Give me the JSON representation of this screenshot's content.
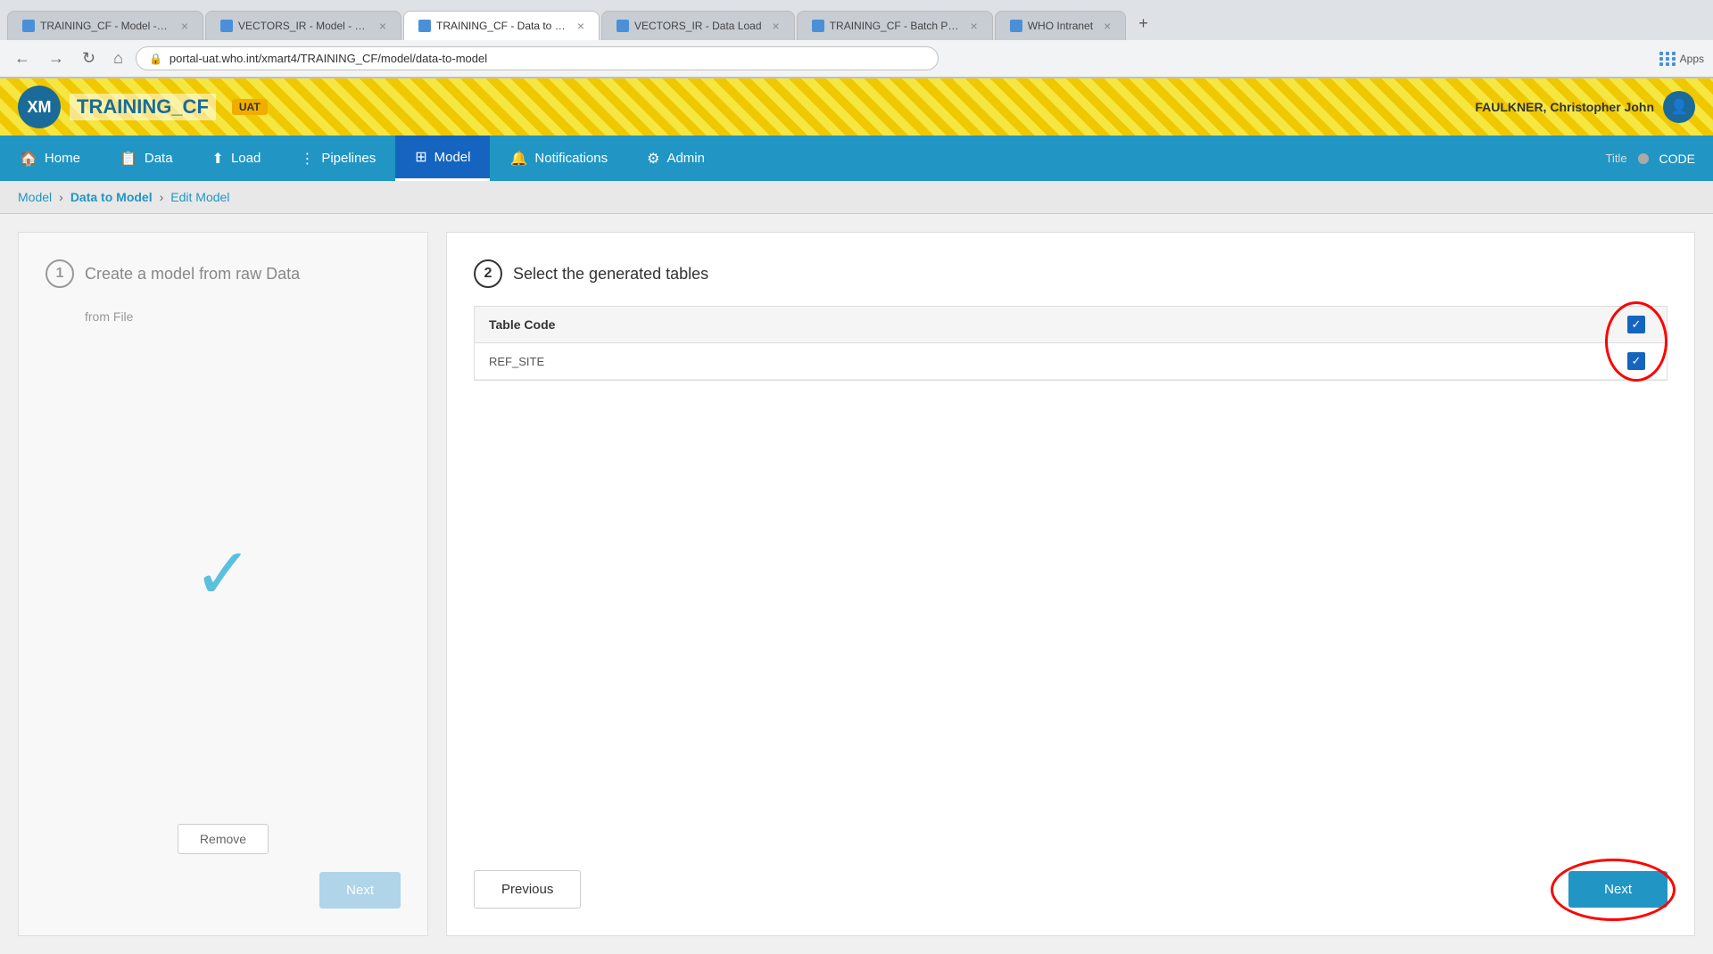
{
  "browser": {
    "tabs": [
      {
        "label": "TRAINING_CF - Model - Edit",
        "active": false,
        "favicon_color": "#4a90d9"
      },
      {
        "label": "VECTORS_IR - Model - Edit",
        "active": false,
        "favicon_color": "#4a90d9"
      },
      {
        "label": "TRAINING_CF - Data to Mo...",
        "active": true,
        "favicon_color": "#4a90d9"
      },
      {
        "label": "VECTORS_IR - Data Load",
        "active": false,
        "favicon_color": "#4a90d9"
      },
      {
        "label": "TRAINING_CF - Batch Previ...",
        "active": false,
        "favicon_color": "#4a90d9"
      },
      {
        "label": "WHO Intranet",
        "active": false,
        "favicon_color": "#4a90d9"
      }
    ],
    "url": "portal-uat.who.int/xmart4/TRAINING_CF/model/data-to-model"
  },
  "header": {
    "logo_text": "TRAINING_CF",
    "badge": "UAT",
    "user_name": "FAULKNER, Christopher John"
  },
  "nav": {
    "items": [
      {
        "label": "Home",
        "icon": "🏠",
        "active": false
      },
      {
        "label": "Data",
        "icon": "📋",
        "active": false
      },
      {
        "label": "Load",
        "icon": "⬆",
        "active": false
      },
      {
        "label": "Pipelines",
        "icon": "⋮",
        "active": false
      },
      {
        "label": "Model",
        "icon": "⊞",
        "active": true
      },
      {
        "label": "Notifications",
        "icon": "🔔",
        "active": false
      },
      {
        "label": "Admin",
        "icon": "⚙",
        "active": false
      }
    ],
    "title_label": "Title",
    "code_label": "CODE"
  },
  "breadcrumb": {
    "items": [
      {
        "label": "Model",
        "active": false
      },
      {
        "label": "Data to Model",
        "active": true
      },
      {
        "label": "Edit Model",
        "active": false
      }
    ]
  },
  "step1": {
    "number": "1",
    "title": "Create a model from raw Data",
    "subtitle": "from File",
    "checkmark": "✓",
    "remove_button": "Remove",
    "next_button": "Next"
  },
  "step2": {
    "number": "2",
    "title": "Select the generated tables",
    "table": {
      "column_header": "Table Code",
      "rows": [
        {
          "code": "REF_SITE",
          "checked": true
        }
      ]
    },
    "previous_button": "Previous",
    "next_button": "Next"
  }
}
